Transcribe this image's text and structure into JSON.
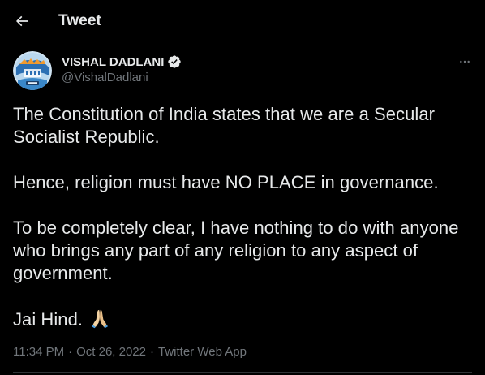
{
  "header": {
    "title": "Tweet",
    "back_icon": "arrow-left-icon"
  },
  "author": {
    "display_name": "VISHAL DADLANI",
    "handle": "@VishalDadlani",
    "verified": true,
    "verified_color": "#1d9bf0",
    "avatar_icon": "avatar-image"
  },
  "tweet": {
    "paragraphs": [
      "The Constitution of India states that we are a Secular Socialist Republic.",
      "Hence, religion must have NO PLACE in governance.",
      "To be completely clear, I have nothing to do with anyone who brings any part of any religion to any aspect of government.",
      "Jai Hind."
    ],
    "emoji": "folded-hands-emoji"
  },
  "meta": {
    "time": "11:34 PM",
    "separator": "·",
    "date": "Oct 26, 2022",
    "source": "Twitter Web App"
  },
  "colors": {
    "background": "#000000",
    "text": "#e7e9ea",
    "secondary": "#71767b",
    "accent": "#1d9bf0",
    "divider": "#2f3336"
  }
}
